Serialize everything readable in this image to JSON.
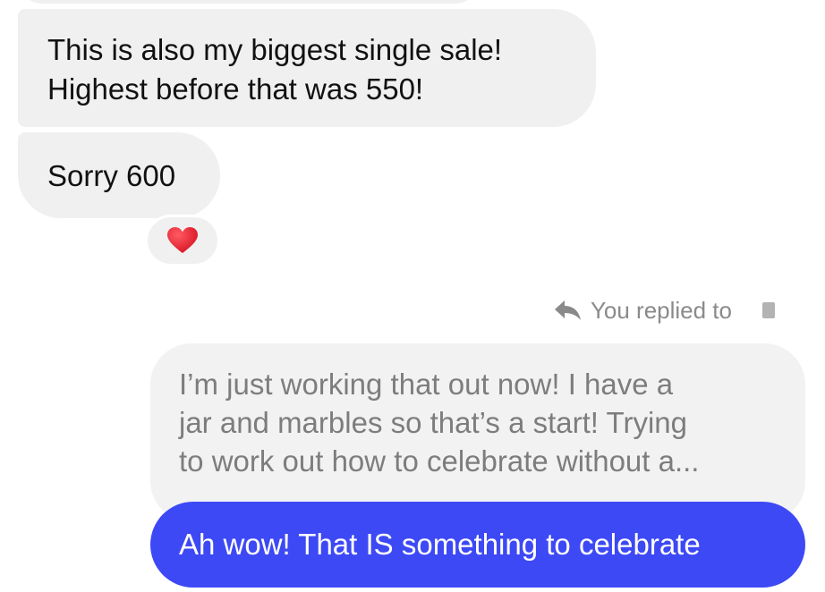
{
  "messages": {
    "received": [
      {
        "line1": "This is also my biggest single sale!",
        "line2": "Highest before that was 550!"
      },
      {
        "text": "Sorry 600",
        "reaction": "heart-emoji"
      }
    ],
    "reply_indicator": {
      "label": "You replied to",
      "icon": "reply-arrow-icon"
    },
    "quoted_reply": {
      "line1": "I’m just working that out now! I have a",
      "line2": "jar and marbles so that’s a start! Trying",
      "line3": "to work out how to celebrate without a..."
    },
    "sent": [
      {
        "text": "Ah wow! That IS something to celebrate"
      }
    ]
  },
  "colors": {
    "received_bubble": "#f0f0f0",
    "sent_bubble": "#3d49f5",
    "quoted_text": "#7d7d7d",
    "heart": "#e0202e"
  }
}
